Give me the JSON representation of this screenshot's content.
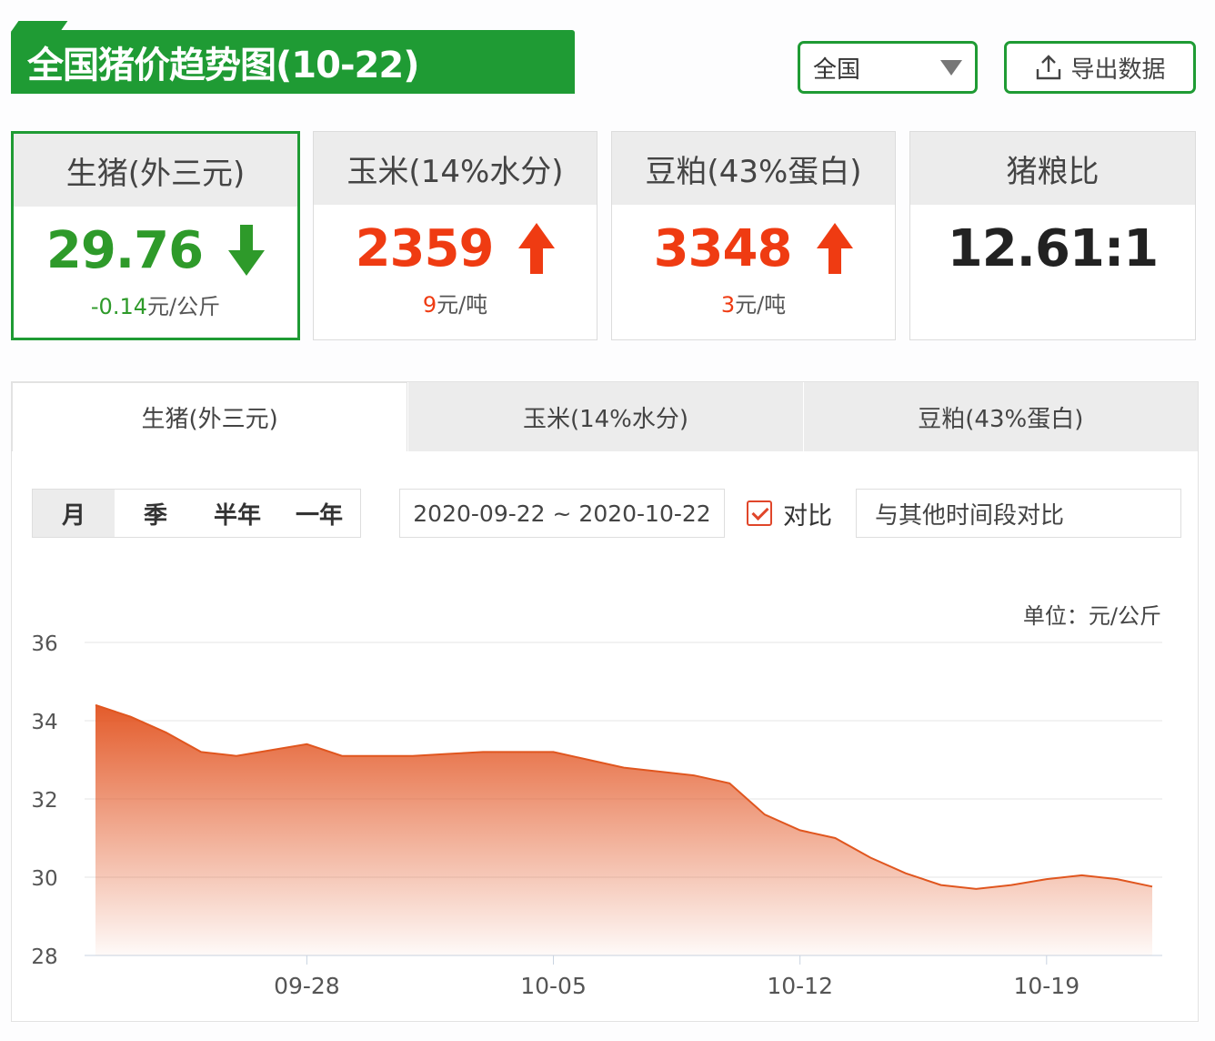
{
  "header": {
    "title": "全国猪价趋势图(10-22)",
    "region": "全国",
    "export_label": "导出数据"
  },
  "cards": [
    {
      "title": "生猪(外三元)",
      "value": "29.76",
      "direction": "down",
      "change": "-0.14",
      "unit": "元/公斤",
      "color": "#2e9a2a"
    },
    {
      "title": "玉米(14%水分)",
      "value": "2359",
      "direction": "up",
      "change": "9",
      "unit": "元/吨",
      "color": "#ef3b12"
    },
    {
      "title": "豆粕(43%蛋白)",
      "value": "3348",
      "direction": "up",
      "change": "3",
      "unit": "元/吨",
      "color": "#ef3b12"
    },
    {
      "title": "猪粮比",
      "value": "12.61:1"
    }
  ],
  "tabs": [
    "生猪(外三元)",
    "玉米(14%水分)",
    "豆粕(43%蛋白)"
  ],
  "range_buttons": [
    "月",
    "季",
    "半年",
    "一年"
  ],
  "date_range": "2020-09-22 ~ 2020-10-22",
  "compare": {
    "label": "对比",
    "checked": true,
    "placeholder": "与其他时间段对比"
  },
  "chart_data": {
    "type": "area",
    "unit_label": "单位：元/公斤",
    "x": [
      "09-22",
      "09-23",
      "09-24",
      "09-25",
      "09-26",
      "09-27",
      "09-28",
      "09-29",
      "09-30",
      "10-01",
      "10-02",
      "10-03",
      "10-04",
      "10-05",
      "10-06",
      "10-07",
      "10-08",
      "10-09",
      "10-10",
      "10-11",
      "10-12",
      "10-13",
      "10-14",
      "10-15",
      "10-16",
      "10-17",
      "10-18",
      "10-19",
      "10-20",
      "10-21",
      "10-22"
    ],
    "values": [
      34.4,
      34.1,
      33.7,
      33.2,
      33.1,
      33.25,
      33.4,
      33.1,
      33.1,
      33.1,
      33.15,
      33.2,
      33.2,
      33.2,
      33.0,
      32.8,
      32.7,
      32.6,
      32.4,
      31.6,
      31.2,
      31.0,
      30.5,
      30.1,
      29.8,
      29.7,
      29.8,
      29.95,
      30.05,
      29.95,
      29.76
    ],
    "xticks": [
      "09-28",
      "10-05",
      "10-12",
      "10-19"
    ],
    "yticks": [
      28,
      30,
      32,
      34,
      36
    ],
    "ylim": [
      28,
      36
    ],
    "color": "#e25320"
  }
}
